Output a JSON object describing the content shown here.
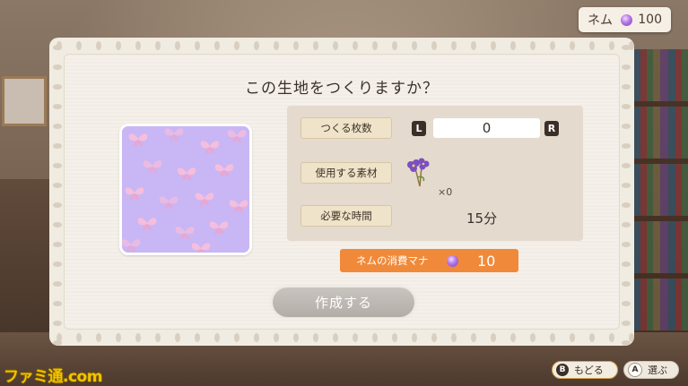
{
  "currency": {
    "name": "ネム",
    "amount": "100",
    "gem_color": "#b276e6"
  },
  "dialog": {
    "title": "この生地をつくりますか？",
    "quantity_label": "つくる枚数",
    "quantity_value": "0",
    "l_key": "L",
    "r_key": "R",
    "material_label": "使用する素材",
    "material_icon": "violet-flower-icon",
    "material_count": "×0",
    "time_label": "必要な時間",
    "time_value": "15分",
    "mana_label": "ネムの消費マナ",
    "mana_value": "10",
    "create_button": "作成する",
    "fabric_pattern": "pink-butterfly-on-lavender"
  },
  "hints": {
    "back_key": "B",
    "back_label": "もどる",
    "select_key": "A",
    "select_label": "選ぶ"
  },
  "watermark": "ファミ通.com",
  "colors": {
    "accent_orange": "#f08a3a",
    "fabric_bg": "#c7b4f3",
    "butterfly": "#f2b6d6"
  }
}
